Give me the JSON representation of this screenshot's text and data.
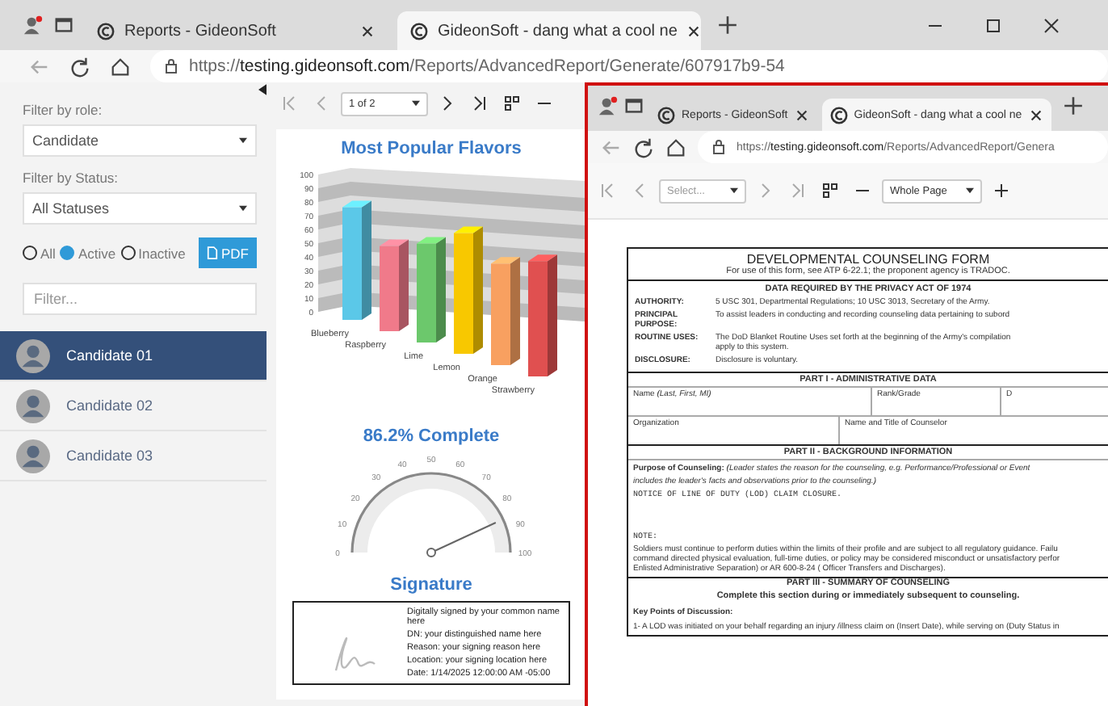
{
  "back_window": {
    "tabs": [
      {
        "title": "Reports - GideonSoft",
        "selected": false
      },
      {
        "title": "GideonSoft - dang what a cool ne",
        "selected": true
      }
    ],
    "url": "https://**testing.gideonsoft.com**/Reports/AdvancedReport/Generate/607917b9-54",
    "sidebar": {
      "role_label": "Filter by role:",
      "role_value": "Candidate",
      "status_label": "Filter by Status:",
      "status_value": "All Statuses",
      "radios": [
        {
          "label": "All",
          "selected": false
        },
        {
          "label": "Active",
          "selected": true
        },
        {
          "label": "Inactive",
          "selected": false
        }
      ],
      "pdf_button": "PDF",
      "filter_placeholder": "Filter...",
      "candidates": [
        {
          "name": "Candidate 01",
          "selected": true
        },
        {
          "name": "Candidate 02",
          "selected": false
        },
        {
          "name": "Candidate 03",
          "selected": false
        }
      ]
    },
    "toolbar": {
      "page_select": "1 of 2"
    },
    "report": {
      "chart": {
        "title": "Most Popular Flavors",
        "category_labels": [
          "Blueberry",
          "Raspberry",
          "Lime",
          "Lemon",
          "Orange",
          "Strawberry"
        ],
        "axis_labels": [
          "100",
          "90",
          "80",
          "70",
          "60",
          "50",
          "40",
          "30",
          "20",
          "10",
          "0"
        ]
      },
      "bars": [
        {
          "color": "#5bc8e8"
        },
        {
          "color": "#f07a8a"
        },
        {
          "color": "#6cc86c"
        },
        {
          "color": "#f8c800"
        },
        {
          "color": "#f8a060"
        },
        {
          "color": "#e05050"
        }
      ],
      "gauge": {
        "title": "86.2% Complete",
        "level": 0.862,
        "ticks": [
          "0",
          "10",
          "20",
          "30",
          "40",
          "50",
          "60",
          "70",
          "80",
          "90",
          "100"
        ]
      },
      "signature": {
        "title": "Signature",
        "lines": [
          "Digitally signed by your common name here",
          "DN: your distinguished name here",
          "Reason: your signing reason here",
          "Location: your signing location here",
          "Date: 1/14/2025 12:00:00 AM -05:00"
        ]
      }
    }
  },
  "front_window": {
    "tabs": [
      {
        "title": "Reports - GideonSoft",
        "selected": false
      },
      {
        "title": "GideonSoft - dang what a cool ne",
        "selected": true
      }
    ],
    "url": "https://**testing.gideonsoft.com**/Reports/AdvancedReport/Genera",
    "toolbar": {
      "page_select": "Select...",
      "zoom_select": "Whole Page"
    },
    "document": {
      "title": "DEVELOPMENTAL COUNSELING FORM",
      "subtitle": "For use of this form, see ATP 6-22.1; the proponent agency is TRADOC.",
      "privacy_heading": "DATA REQUIRED BY THE PRIVACY ACT OF 1974",
      "privacy_rows": [
        {
          "label": "AUTHORITY:",
          "lines": [
            "5 USC 301, Departmental Regulations; 10 USC 3013, Secretary of the Army."
          ]
        },
        {
          "label": "PRINCIPAL PURPOSE:",
          "lines": [
            "To assist leaders in conducting and recording counseling data pertaining to subord"
          ]
        },
        {
          "label": "ROUTINE USES:",
          "lines": [
            "The DoD Blanket Routine Uses set forth at the beginning of the Army's compilation",
            "apply to this system."
          ]
        },
        {
          "label": "DISCLOSURE:",
          "lines": [
            "Disclosure is voluntary."
          ]
        }
      ],
      "part1_heading": "PART I - ADMINISTRATIVE DATA",
      "name_label": "Name",
      "name_hint": "(Last, First, MI)",
      "rank_label": "Rank/Grade",
      "column_3": "D",
      "org_label": "Organization",
      "counselor_label": "Name and Title of Counselor",
      "part2_heading": "PART II - BACKGROUND INFORMATION",
      "purpose_label": "Purpose of Counseling:",
      "purpose_hint": "(Leader states the reason for the counseling, e.g. Performance/Professional or Event",
      "purpose_hint_2": "includes the leader's facts and observations prior to the counseling.)",
      "purpose_entry": "NOTICE OF LINE OF DUTY  (LOD) CLAIM CLOSURE.",
      "note_label": "NOTE:",
      "note_lines": [
        "Soldiers must continue to perform duties within the limits of their profile and are subject to all regulatory guidance. Failu",
        "command directed physical evaluation, full-time duties, or policy may be considered misconduct or unsatisfactory perfor",
        "Enlisted Administrative Separation) or AR 600-8-24 ( Officer Transfers and Discharges)."
      ],
      "part3_heading": "PART III - SUMMARY OF COUNSELING",
      "part3_sub": "Complete this section during or immediately subsequent to counseling.",
      "key_points_label": "Key Points of Discussion:",
      "key_point": "1- A LOD was initiated on your behalf regarding an injury /illness claim on (Insert Date), while serving on (Duty Status in"
    }
  }
}
